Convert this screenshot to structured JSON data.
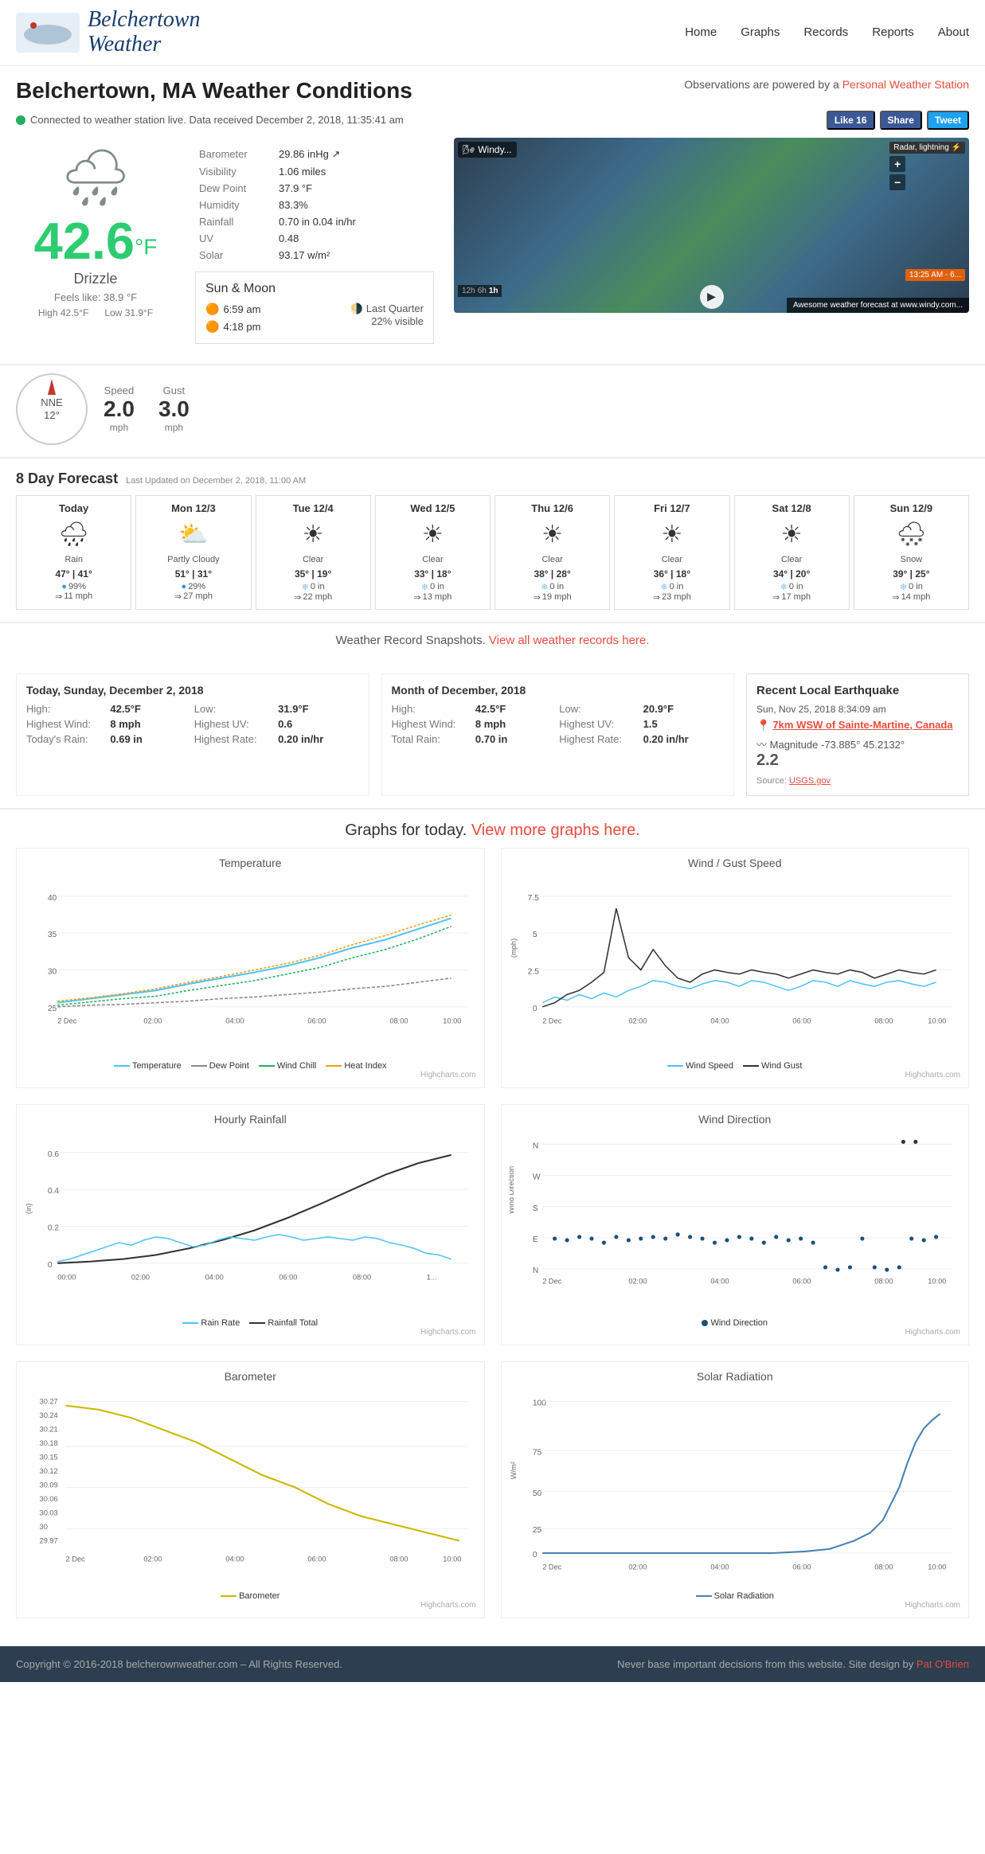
{
  "header": {
    "logo_line1": "Belchertown",
    "logo_line2": "Weather",
    "nav_items": [
      "Home",
      "Graphs",
      "Records",
      "Reports",
      "About"
    ]
  },
  "page": {
    "title": "Belchertown, MA Weather Conditions",
    "pws_label": "Observations are powered by a",
    "pws_link_text": "Personal Weather Station",
    "status_text": "Connected to weather station live. Data received December 2, 2018, 11:35:41 am"
  },
  "social": {
    "like_label": "Like 16",
    "share_label": "Share",
    "tweet_label": "Tweet"
  },
  "current": {
    "temp": "42.6",
    "temp_unit": "°F",
    "condition": "Drizzle",
    "feels_like": "Feels like: 38.9 °F",
    "high": "42.5°F",
    "low": "31.9°F",
    "barometer": "29.86 inHg ↗",
    "visibility": "1.06 miles",
    "dew_point": "37.9 °F",
    "humidity": "83.3%",
    "rainfall": "0.70 in  0.04 in/hr",
    "uv": "0.48",
    "solar": "93.17 w/m²"
  },
  "sun_moon": {
    "title": "Sun & Moon",
    "sunrise": "6:59 am",
    "sunset": "4:18 pm",
    "moon_phase": "Last Quarter",
    "moon_visible": "22% visible"
  },
  "wind": {
    "direction": "NNE",
    "degrees": "12°",
    "speed": "2.0",
    "gust": "3.0",
    "unit": "mph"
  },
  "forecast": {
    "title": "8 Day Forecast",
    "updated": "Last Updated on December 2, 2018, 11:00 AM",
    "days": [
      {
        "name": "Today",
        "icon": "🌧",
        "desc": "Rain",
        "high": "47°",
        "low": "41°",
        "detail": "99%",
        "detail_type": "rain",
        "wind": "11 mph"
      },
      {
        "name": "Mon 12/3",
        "icon": "⛅",
        "desc": "Partly Cloudy",
        "high": "51°",
        "low": "31°",
        "detail": "29%",
        "detail_type": "rain",
        "wind": "27 mph"
      },
      {
        "name": "Tue 12/4",
        "icon": "☀",
        "desc": "Clear",
        "high": "35°",
        "low": "19°",
        "detail": "0 in",
        "detail_type": "snow",
        "wind": "22 mph"
      },
      {
        "name": "Wed 12/5",
        "icon": "☀",
        "desc": "Clear",
        "high": "33°",
        "low": "18°",
        "detail": "0 in",
        "detail_type": "snow",
        "wind": "13 mph"
      },
      {
        "name": "Thu 12/6",
        "icon": "☀",
        "desc": "Clear",
        "high": "38°",
        "low": "28°",
        "detail": "0 in",
        "detail_type": "snow",
        "wind": "19 mph"
      },
      {
        "name": "Fri 12/7",
        "icon": "☀",
        "desc": "Clear",
        "high": "36°",
        "low": "18°",
        "detail": "0 in",
        "detail_type": "snow",
        "wind": "23 mph"
      },
      {
        "name": "Sat 12/8",
        "icon": "☀",
        "desc": "Clear",
        "high": "34°",
        "low": "20°",
        "detail": "0 in",
        "detail_type": "snow",
        "wind": "17 mph"
      },
      {
        "name": "Sun 12/9",
        "icon": "🌨",
        "desc": "Snow",
        "high": "39°",
        "low": "25°",
        "detail": "0 in",
        "detail_type": "snow",
        "wind": "14 mph"
      }
    ]
  },
  "records": {
    "snapshot_title": "Weather Record Snapshots.",
    "snapshot_link": "View all weather records here.",
    "today": {
      "label": "Today, Sunday, December 2, 2018",
      "high_label": "High:",
      "high_val": "42.5°F",
      "low_label": "Low:",
      "low_val": "31.9°F",
      "highest_wind_label": "Highest Wind:",
      "highest_wind_val": "8 mph",
      "highest_uv_label": "Highest UV:",
      "highest_uv_val": "0.6",
      "rain_label": "Today's Rain:",
      "rain_val": "0.69 in",
      "highest_rate_label": "Highest Rate:",
      "highest_rate_val": "0.20 in/hr"
    },
    "month": {
      "label": "Month of December, 2018",
      "high_label": "High:",
      "high_val": "42.5°F",
      "low_label": "Low:",
      "low_val": "20.9°F",
      "highest_wind_label": "Highest Wind:",
      "highest_wind_val": "8 mph",
      "highest_uv_label": "Highest UV:",
      "highest_uv_val": "1.5",
      "total_rain_label": "Total Rain:",
      "total_rain_val": "0.70 in",
      "highest_rate_label": "Highest Rate:",
      "highest_rate_val": "0.20 in/hr"
    }
  },
  "earthquake": {
    "title": "Recent Local Earthquake",
    "date": "Sun, Nov 25, 2018 8:34:09 am",
    "location": "7km WSW of Sainte-Martine, Canada",
    "magnitude_label": "Magnitude",
    "magnitude": "2.2",
    "coords": "-73.885° 45.2132°",
    "source_label": "Source:",
    "source_link": "USGS.gov"
  },
  "graphs": {
    "title": "Graphs for today.",
    "link_text": "View more graphs here.",
    "charts": [
      {
        "id": "temperature",
        "title": "Temperature",
        "legend": [
          "Temperature",
          "Dew Point",
          "Wind Chill",
          "Heat Index"
        ],
        "legend_colors": [
          "#4fc3f7",
          "#888",
          "#27ae60",
          "#f39c12"
        ]
      },
      {
        "id": "wind_gust",
        "title": "Wind / Gust Speed",
        "legend": [
          "Wind Speed",
          "Wind Gust"
        ],
        "legend_colors": [
          "#4fc3f7",
          "#333"
        ]
      },
      {
        "id": "rainfall",
        "title": "Hourly Rainfall",
        "legend": [
          "Rain Rate",
          "Rainfall Total"
        ],
        "legend_colors": [
          "#4fc3f7",
          "#333"
        ]
      },
      {
        "id": "wind_direction",
        "title": "Wind Direction",
        "legend": [
          "Wind Direction"
        ],
        "legend_colors": [
          "#1a5276"
        ]
      },
      {
        "id": "barometer",
        "title": "Barometer",
        "legend": [
          "Barometer"
        ],
        "legend_colors": [
          "#c9b800"
        ]
      },
      {
        "id": "solar",
        "title": "Solar Radiation",
        "legend": [
          "Solar Radiation"
        ],
        "legend_colors": [
          "#4682b4"
        ]
      }
    ]
  },
  "footer": {
    "copyright": "Copyright © 2016-2018 belcherownweather.com – All Rights Reserved.",
    "disclaimer": "Never base important decisions from this website.",
    "site_design_label": "Site design by",
    "designer": "Pat O'Brien",
    "designer_link": "#"
  }
}
